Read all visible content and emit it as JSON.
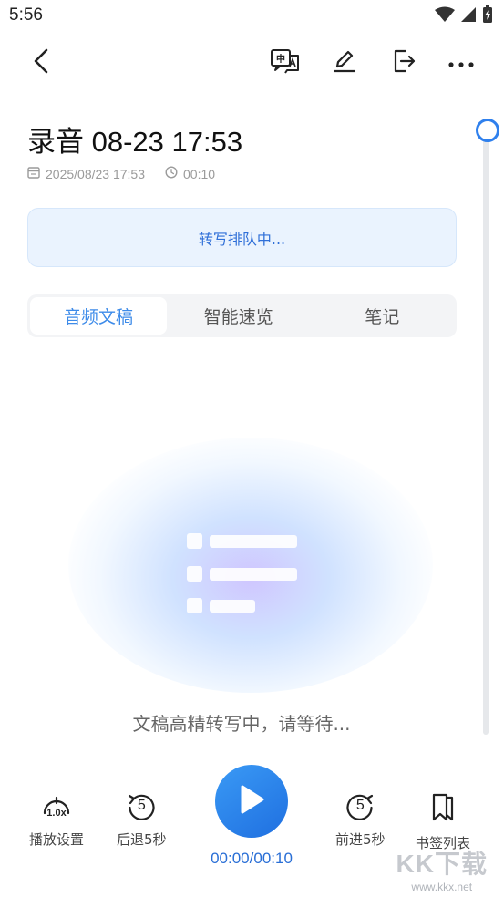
{
  "status_bar": {
    "time": "5:56"
  },
  "recording": {
    "title": "录音 08-23 17:53",
    "date": "2025/08/23 17:53",
    "duration": "00:10"
  },
  "banner": {
    "text": "转写排队中..."
  },
  "tabs": [
    {
      "label": "音频文稿",
      "active": true
    },
    {
      "label": "智能速览",
      "active": false
    },
    {
      "label": "笔记",
      "active": false
    }
  ],
  "transcript": {
    "status_text": "文稿高精转写中，请等待..."
  },
  "player": {
    "speed_value": "1.0x",
    "speed_label": "播放设置",
    "rewind_value": "5",
    "rewind_label": "后退5秒",
    "forward_value": "5",
    "forward_label": "前进5秒",
    "bookmarks_label": "书签列表",
    "time": "00:00/00:10"
  },
  "watermark": {
    "logo": "KK下载",
    "url": "www.kkx.net"
  },
  "colors": {
    "accent": "#2f80ed",
    "banner_bg": "#eaf3fe",
    "tab_bg": "#f3f4f6"
  }
}
